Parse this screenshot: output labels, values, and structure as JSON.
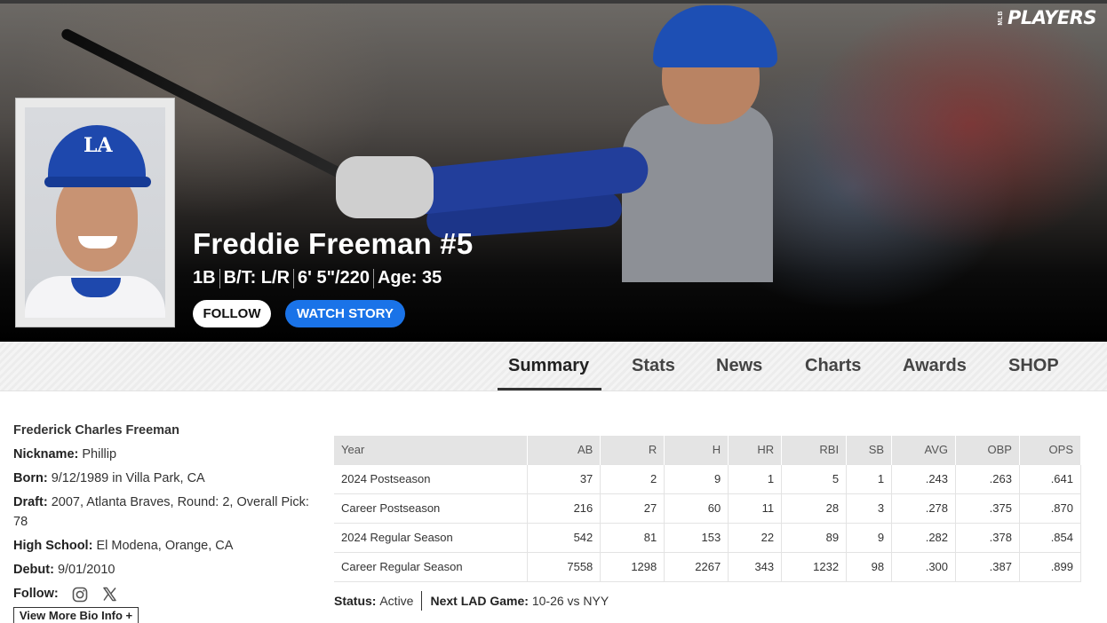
{
  "brand": {
    "mlb": "MLB",
    "players": "PLAYERS"
  },
  "player": {
    "name": "Freddie Freeman #5",
    "position": "1B",
    "bats_throws": "B/T: L/R",
    "height_weight": "6' 5\"/220",
    "age": "Age: 35"
  },
  "buttons": {
    "follow": "FOLLOW",
    "watch_story": "WATCH STORY"
  },
  "nav": {
    "tabs": [
      "Summary",
      "Stats",
      "News",
      "Charts",
      "Awards",
      "SHOP"
    ],
    "active": "Summary"
  },
  "bio": {
    "full_name": "Frederick Charles Freeman",
    "nickname_label": "Nickname:",
    "nickname": "Phillip",
    "born_label": "Born:",
    "born": "9/12/1989 in Villa Park, CA",
    "draft_label": "Draft:",
    "draft": "2007, Atlanta Braves, Round: 2, Overall Pick: 78",
    "high_school_label": "High School:",
    "high_school": "El Modena, Orange, CA",
    "debut_label": "Debut:",
    "debut": "9/01/2010",
    "follow_label": "Follow:",
    "view_more": "View More Bio Info +"
  },
  "stats_table": {
    "headers": [
      "Year",
      "AB",
      "R",
      "H",
      "HR",
      "RBI",
      "SB",
      "AVG",
      "OBP",
      "OPS"
    ],
    "rows": [
      [
        "2024 Postseason",
        "37",
        "2",
        "9",
        "1",
        "5",
        "1",
        ".243",
        ".263",
        ".641"
      ],
      [
        "Career Postseason",
        "216",
        "27",
        "60",
        "11",
        "28",
        "3",
        ".278",
        ".375",
        ".870"
      ],
      [
        "2024 Regular Season",
        "542",
        "81",
        "153",
        "22",
        "89",
        "9",
        ".282",
        ".378",
        ".854"
      ],
      [
        "Career Regular Season",
        "7558",
        "1298",
        "2267",
        "343",
        "1232",
        "98",
        ".300",
        ".387",
        ".899"
      ]
    ]
  },
  "status": {
    "status_label": "Status:",
    "status_value": "Active",
    "next_game_label": "Next LAD Game:",
    "next_game_value": "10-26 vs NYY"
  },
  "colors": {
    "accent_blue": "#1a73e8",
    "dodger_blue": "#1e48ad"
  }
}
